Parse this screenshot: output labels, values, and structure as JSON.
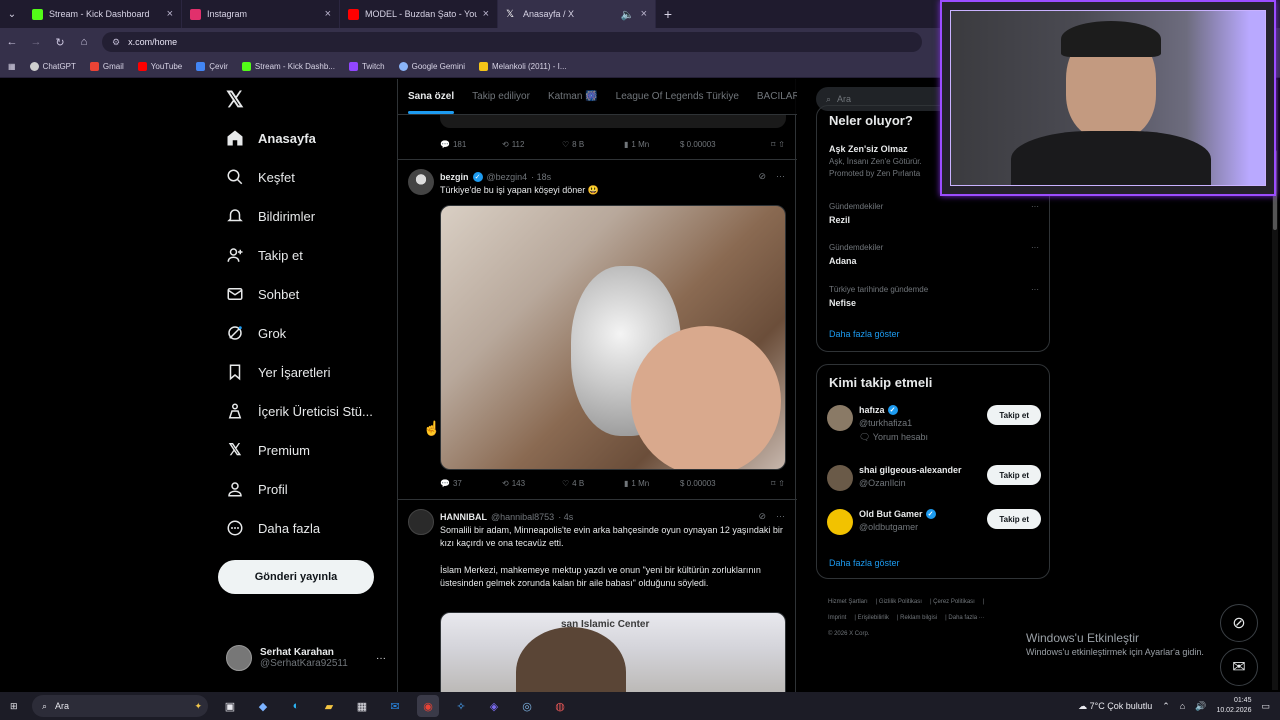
{
  "browser": {
    "tabs": [
      {
        "title": "Stream - Kick Dashboard",
        "color": "#53fc18"
      },
      {
        "title": "Instagram",
        "color": "#e1306c"
      },
      {
        "title": "MODEL - Buzdan Şato - YouTube",
        "color": "#ff0000"
      },
      {
        "title": "Anasayfa / X",
        "color": "#ffffff"
      }
    ],
    "url": "x.com/home",
    "bookmarks": [
      "ChatGPT",
      "Gmail",
      "YouTube",
      "Çevir",
      "Stream - Kick Dashb...",
      "Twitch",
      "Google Gemini",
      "Melankoli (2011) - I..."
    ]
  },
  "nav": {
    "items": [
      "Anasayfa",
      "Keşfet",
      "Bildirimler",
      "Takip et",
      "Sohbet",
      "Grok",
      "Yer İşaretleri",
      "İçerik Üreticisi Stü...",
      "Premium",
      "Profil",
      "Daha fazla"
    ],
    "post_button": "Gönderi yayınla",
    "profile_name": "Serhat Karahan",
    "profile_handle": "@SerhatKara92511"
  },
  "feed": {
    "tabs": [
      "Sana özel",
      "Takip ediliyor",
      "Katman 🎆",
      "League Of Legends Türkiye",
      "BACILAR"
    ],
    "top_actions": {
      "replies": "181",
      "reposts": "112",
      "likes": "8 B",
      "views": "1 Mn",
      "money": "$ 0.00003"
    },
    "tweet1": {
      "name": "bezgin",
      "handle": "@bezgin4",
      "time": "· 18s",
      "text": "Türkiye'de bu işi yapan köşeyi döner 😃",
      "replies": "37",
      "reposts": "143",
      "likes": "4 B",
      "views": "1 Mn",
      "money": "$ 0.00003"
    },
    "tweet2": {
      "name": "HANNIBAL",
      "handle": "@hannibal8753",
      "time": "· 4s",
      "text1": "Somalili bir adam, Minneapolis'te evin arka bahçesinde oyun oynayan 12 yaşındaki bir kızı kaçırdı ve ona tecavüz etti.",
      "text2": "İslam Merkezi, mahkemeye mektup yazdı ve onun \"yeni bir kültürün zorluklarının üstesinden gelmek zorunda kalan bir aile babası\" olduğunu söyledi.",
      "media_sign": "san Islamic Center"
    }
  },
  "sidebar": {
    "search_placeholder": "Ara",
    "happening_title": "Neler oluyor?",
    "promo_title": "Aşk Zen'siz Olmaz",
    "promo_sub": "Aşk, İnsanı Zen'e Götürür.",
    "promo_by": "Promoted by Zen Pırlanta",
    "trends": [
      {
        "category": "Gündemdekiler",
        "title": "Rezil"
      },
      {
        "category": "Gündemdekiler",
        "title": "Adana"
      },
      {
        "category": "Türkiye tarihinde gündemde",
        "title": "Nefise"
      }
    ],
    "show_more": "Daha fazla göster",
    "who_title": "Kimi takip etmeli",
    "who": [
      {
        "name": "hafıza",
        "handle": "@turkhafiza1",
        "sub": "Yorum hesabı",
        "verified": true
      },
      {
        "name": "shai gilgeous-alexander",
        "handle": "@OzanIlcin",
        "sub": "",
        "verified": false
      },
      {
        "name": "Old But Gamer",
        "handle": "@oldbutgamer",
        "sub": "",
        "verified": true
      }
    ],
    "follow_label": "Takip et",
    "footer": [
      "Hizmet Şartları",
      "Gizlilik Politikası",
      "Çerez Politikası",
      "Imprint",
      "Erişilebilirlik",
      "Reklam bilgisi",
      "Daha fazla ···",
      "© 2026 X Corp."
    ]
  },
  "overlay": {
    "watermark_title": "Windows'u Etkinleştir",
    "watermark_sub": "Windows'u etkinleştirmek için Ayarlar'a gidin."
  },
  "taskbar": {
    "search": "Ara",
    "weather": "7°C  Çok bulutlu",
    "time": "01:45",
    "date": "10.02.2026"
  }
}
